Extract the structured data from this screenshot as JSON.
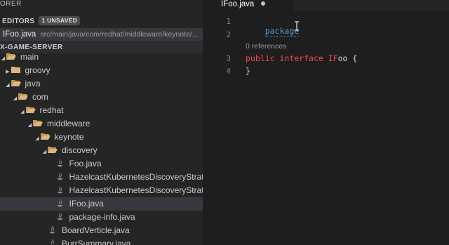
{
  "sidebar": {
    "explorer_title": "ORER",
    "open_editors": {
      "title": "EDITORS",
      "badge": "1 UNSAVED"
    },
    "open_file": {
      "name": "IFoo.java",
      "path": "src/main/java/com/redhat/middleware/keynote/..."
    },
    "project_title": "X-GAME-SERVER",
    "tree": [
      {
        "label": "main",
        "depth": 0,
        "type": "folder",
        "open": true
      },
      {
        "label": "groovy",
        "depth": 1,
        "type": "folder",
        "open": false
      },
      {
        "label": "java",
        "depth": 1,
        "type": "folder",
        "open": true
      },
      {
        "label": "com",
        "depth": 2,
        "type": "folder",
        "open": true
      },
      {
        "label": "redhat",
        "depth": 3,
        "type": "folder",
        "open": true
      },
      {
        "label": "middleware",
        "depth": 4,
        "type": "folder",
        "open": true
      },
      {
        "label": "keynote",
        "depth": 5,
        "type": "folder",
        "open": true
      },
      {
        "label": "discovery",
        "depth": 6,
        "type": "folder",
        "open": true
      },
      {
        "label": "Foo.java",
        "depth": 7,
        "type": "java",
        "open": false
      },
      {
        "label": "HazelcastKubernetesDiscoveryStrate...",
        "depth": 7,
        "type": "java",
        "open": false
      },
      {
        "label": "HazelcastKubernetesDiscoveryStrate...",
        "depth": 7,
        "type": "java",
        "open": false
      },
      {
        "label": "IFoo.java",
        "depth": 7,
        "type": "java",
        "open": false,
        "selected": true
      },
      {
        "label": "package-info.java",
        "depth": 7,
        "type": "java",
        "open": false
      },
      {
        "label": "BoardVerticle.java",
        "depth": 6,
        "type": "java",
        "open": false
      },
      {
        "label": "BurrSummary.java",
        "depth": 6,
        "type": "java",
        "open": false
      }
    ]
  },
  "editor": {
    "tab_title": "IFoo.java",
    "line_numbers": [
      "1",
      "2",
      "3",
      "4"
    ],
    "codelens": "0 references",
    "line1_keyword": "package",
    "line3": {
      "kw1": "public",
      "kw2": "interface",
      "name_red": "IF",
      "name_rest": "oo",
      "brace": " {"
    },
    "line4": "}"
  },
  "colors": {
    "sidebar_bg": "#252526",
    "editor_bg": "#1e1e1e",
    "selection_bg": "#37373d",
    "keyword_blue": "#569cd6",
    "keyword_red": "#f44747"
  }
}
